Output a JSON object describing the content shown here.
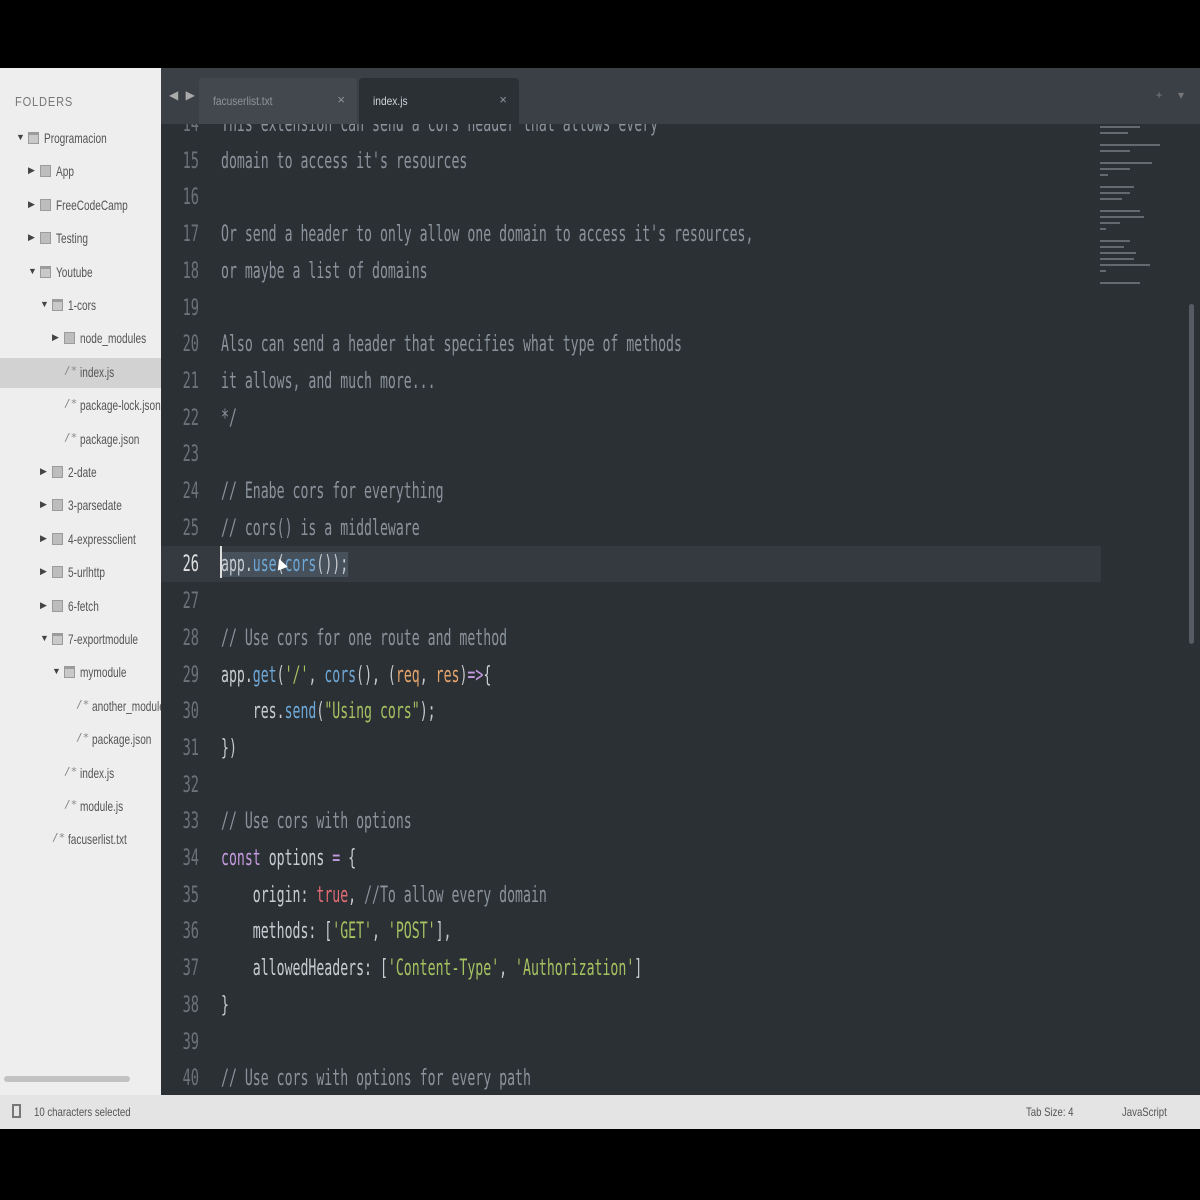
{
  "sidebar": {
    "title": "FOLDERS",
    "items": [
      {
        "label": "Programacion",
        "type": "folder-open",
        "depth": 0,
        "arrow": "▼"
      },
      {
        "label": "App",
        "type": "folder",
        "depth": 1,
        "arrow": "▶"
      },
      {
        "label": "FreeCodeCamp",
        "type": "folder",
        "depth": 1,
        "arrow": "▶"
      },
      {
        "label": "Testing",
        "type": "folder",
        "depth": 1,
        "arrow": "▶"
      },
      {
        "label": "Youtube",
        "type": "folder-open",
        "depth": 1,
        "arrow": "▼"
      },
      {
        "label": "1-cors",
        "type": "folder-open",
        "depth": 2,
        "arrow": "▼"
      },
      {
        "label": "node_modules",
        "type": "folder",
        "depth": 3,
        "arrow": "▶"
      },
      {
        "label": "index.js",
        "type": "file",
        "depth": 3,
        "selected": true
      },
      {
        "label": "package-lock.json",
        "type": "file",
        "depth": 3
      },
      {
        "label": "package.json",
        "type": "file",
        "depth": 3
      },
      {
        "label": "2-date",
        "type": "folder",
        "depth": 2,
        "arrow": "▶"
      },
      {
        "label": "3-parsedate",
        "type": "folder",
        "depth": 2,
        "arrow": "▶"
      },
      {
        "label": "4-expressclient",
        "type": "folder",
        "depth": 2,
        "arrow": "▶"
      },
      {
        "label": "5-urlhttp",
        "type": "folder",
        "depth": 2,
        "arrow": "▶"
      },
      {
        "label": "6-fetch",
        "type": "folder",
        "depth": 2,
        "arrow": "▶"
      },
      {
        "label": "7-exportmodule",
        "type": "folder-open",
        "depth": 2,
        "arrow": "▼"
      },
      {
        "label": "mymodule",
        "type": "folder-open",
        "depth": 3,
        "arrow": "▼"
      },
      {
        "label": "another_module",
        "type": "file",
        "depth": 4
      },
      {
        "label": "package.json",
        "type": "file",
        "depth": 4
      },
      {
        "label": "index.js",
        "type": "file",
        "depth": 3
      },
      {
        "label": "module.js",
        "type": "file",
        "depth": 3
      },
      {
        "label": "facuserlist.txt",
        "type": "file",
        "depth": 2
      }
    ]
  },
  "tabs": [
    {
      "label": "facuserlist.txt",
      "active": false
    },
    {
      "label": "index.js",
      "active": true
    }
  ],
  "tab_close": "×",
  "tab_nav": "◀ ▶",
  "tab_extra": "+ ▾",
  "editor": {
    "active_line": 26,
    "lines": [
      {
        "n": 14,
        "segs": [
          [
            "c-comment",
            "This extension can send a cors header that allows every"
          ]
        ]
      },
      {
        "n": 15,
        "segs": [
          [
            "c-comment",
            "domain to access it's resources"
          ]
        ]
      },
      {
        "n": 16,
        "segs": []
      },
      {
        "n": 17,
        "segs": [
          [
            "c-comment",
            "Or send a header to only allow one domain to access it's resources,"
          ]
        ]
      },
      {
        "n": 18,
        "segs": [
          [
            "c-comment",
            "or maybe a list of domains"
          ]
        ]
      },
      {
        "n": 19,
        "segs": []
      },
      {
        "n": 20,
        "segs": [
          [
            "c-comment",
            "Also can send a header that specifies what type of methods"
          ]
        ]
      },
      {
        "n": 21,
        "segs": [
          [
            "c-comment",
            "it allows, and much more..."
          ]
        ]
      },
      {
        "n": 22,
        "segs": [
          [
            "c-comment",
            "*/"
          ]
        ]
      },
      {
        "n": 23,
        "segs": []
      },
      {
        "n": 24,
        "segs": [
          [
            "c-comment",
            "// Enabe cors for everything"
          ]
        ]
      },
      {
        "n": 25,
        "segs": [
          [
            "c-comment",
            "// cors() is a middleware"
          ]
        ]
      },
      {
        "n": 26,
        "segs": [
          [
            "sel",
            "app."
          ],
          [
            "sel c-fn",
            "use"
          ],
          [
            "sel",
            "("
          ],
          [
            "sel c-fn",
            "cors"
          ],
          [
            "sel",
            "());"
          ]
        ]
      },
      {
        "n": 27,
        "segs": []
      },
      {
        "n": 28,
        "segs": [
          [
            "c-comment",
            "// Use cors for one route and method"
          ]
        ]
      },
      {
        "n": 29,
        "segs": [
          [
            "c-punc",
            "app."
          ],
          [
            "c-fn",
            "get"
          ],
          [
            "c-punc",
            "("
          ],
          [
            "c-str",
            "'/'"
          ],
          [
            "c-punc",
            ", "
          ],
          [
            "c-fn",
            "cors"
          ],
          [
            "c-punc",
            "(), ("
          ],
          [
            "c-var",
            "req"
          ],
          [
            "c-punc",
            ", "
          ],
          [
            "c-var",
            "res"
          ],
          [
            "c-punc",
            ")"
          ],
          [
            "c-kw",
            "=>"
          ],
          [
            "c-punc",
            "{"
          ]
        ]
      },
      {
        "n": 30,
        "segs": [
          [
            "c-punc",
            "    res."
          ],
          [
            "c-fn",
            "send"
          ],
          [
            "c-punc",
            "("
          ],
          [
            "c-str",
            "\"Using cors\""
          ],
          [
            "c-punc",
            ");"
          ]
        ]
      },
      {
        "n": 31,
        "segs": [
          [
            "c-punc",
            "})"
          ]
        ]
      },
      {
        "n": 32,
        "segs": []
      },
      {
        "n": 33,
        "segs": [
          [
            "c-comment",
            "// Use cors with options"
          ]
        ]
      },
      {
        "n": 34,
        "segs": [
          [
            "c-kw",
            "const"
          ],
          [
            "c-punc",
            " options "
          ],
          [
            "c-kw",
            "="
          ],
          [
            "c-punc",
            " {"
          ]
        ]
      },
      {
        "n": 35,
        "segs": [
          [
            "c-punc",
            "    origin: "
          ],
          [
            "c-bool",
            "true"
          ],
          [
            "c-punc",
            ", "
          ],
          [
            "c-comment",
            "//To allow every domain"
          ]
        ]
      },
      {
        "n": 36,
        "segs": [
          [
            "c-punc",
            "    methods: ["
          ],
          [
            "c-str",
            "'GET'"
          ],
          [
            "c-punc",
            ", "
          ],
          [
            "c-str",
            "'POST'"
          ],
          [
            "c-punc",
            "],"
          ]
        ]
      },
      {
        "n": 37,
        "segs": [
          [
            "c-punc",
            "    allowedHeaders: ["
          ],
          [
            "c-str",
            "'Content-Type'"
          ],
          [
            "c-punc",
            ", "
          ],
          [
            "c-str",
            "'Authorization'"
          ],
          [
            "c-punc",
            "]"
          ]
        ]
      },
      {
        "n": 38,
        "segs": [
          [
            "c-punc",
            "}"
          ]
        ]
      },
      {
        "n": 39,
        "segs": []
      },
      {
        "n": 40,
        "segs": [
          [
            "c-comment",
            "// Use cors with options for every path"
          ]
        ]
      }
    ]
  },
  "status": {
    "message": "10 characters selected",
    "tab_size": "Tab Size: 4",
    "syntax": "JavaScript"
  }
}
